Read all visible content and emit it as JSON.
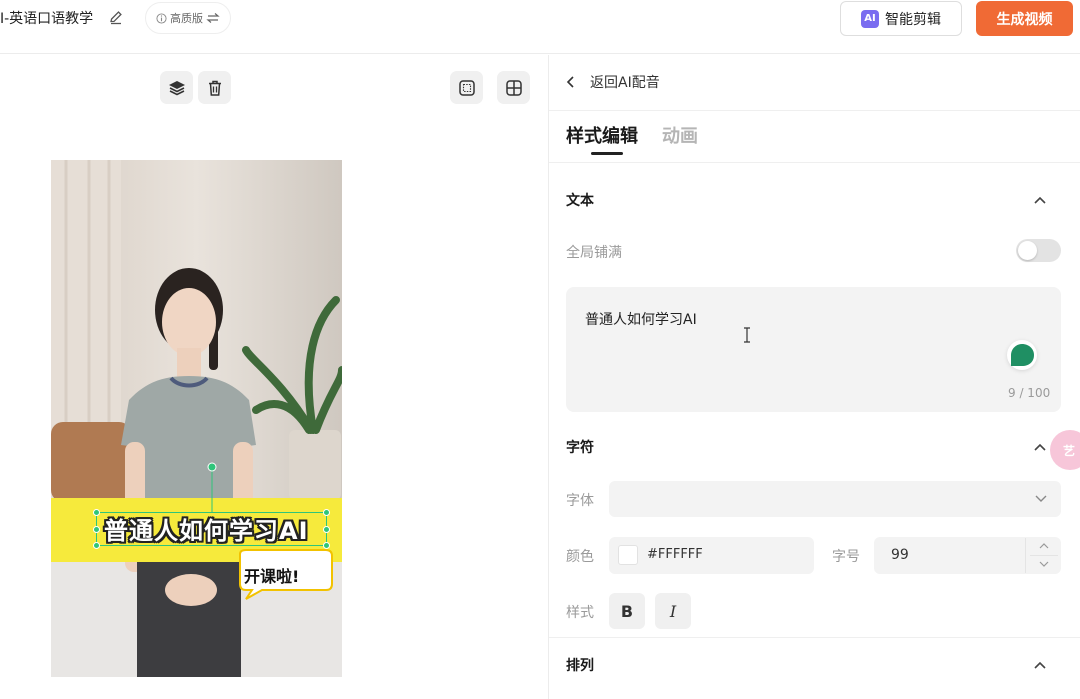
{
  "header": {
    "project_title": "I-英语口语教学",
    "quality_label": "高质版",
    "smart_edit_badge": "AI",
    "smart_edit_label": "智能剪辑",
    "generate_label": "生成视频"
  },
  "preview": {
    "subtitle": "普通人如何学习AI",
    "sticker_text": "开课啦!"
  },
  "panel": {
    "back_label": "返回AI配音",
    "tabs": [
      "样式编辑",
      "动画"
    ],
    "active_tab": 0,
    "text_section": {
      "title": "文本",
      "global_fill_label": "全局铺满",
      "content": "普通人如何学习AI",
      "char_count": "9 / 100"
    },
    "char_section": {
      "title": "字符",
      "font_label": "字体",
      "font_value": "",
      "color_label": "颜色",
      "color_value": "#FFFFFF",
      "size_label": "字号",
      "size_value": "99",
      "style_label": "样式",
      "bold_label": "B",
      "italic_label": "I"
    },
    "arrange_section": {
      "title": "排列"
    },
    "float_label": "艺"
  },
  "colors": {
    "accent_orange": "#f06a35",
    "ai_purple": "#7a6cf0",
    "selection_green": "#2fc57a",
    "subtitle_band": "#f6ea3c"
  }
}
